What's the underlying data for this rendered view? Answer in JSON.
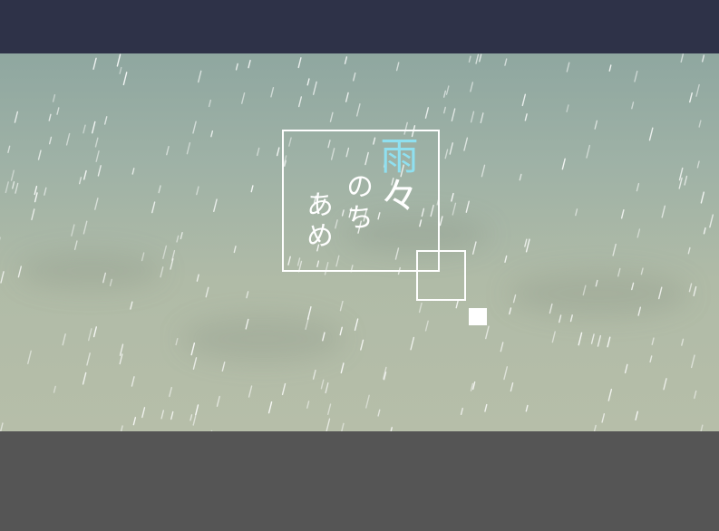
{
  "title": {
    "first_char": "雨",
    "rest_first_col": "々",
    "col2": "のち",
    "col3": "あめ"
  },
  "colors": {
    "top_bar": "#2e3248",
    "bottom_bar": "#555555",
    "title_accent": "#8fe0f0",
    "frame": "#ffffff"
  },
  "icons": {
    "start": "white-square-icon"
  }
}
